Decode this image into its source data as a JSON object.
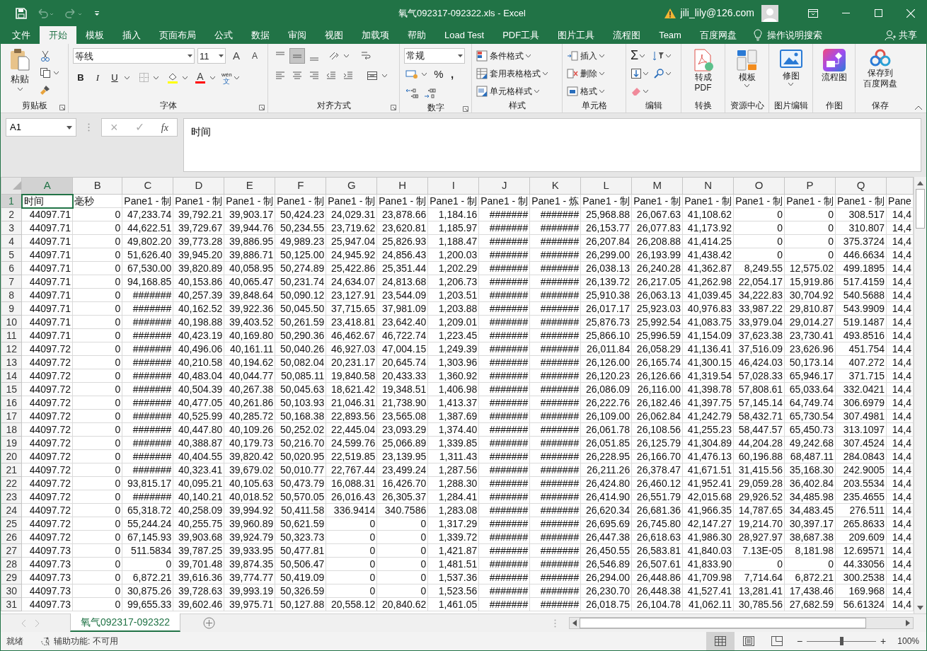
{
  "window": {
    "title": "氧气092317-092322.xls  -  Excel",
    "user": "jili_lily@126.com"
  },
  "ribbon_tabs": [
    {
      "label": "文件",
      "selected": false
    },
    {
      "label": "开始",
      "selected": true
    },
    {
      "label": "模板",
      "selected": false
    },
    {
      "label": "插入",
      "selected": false
    },
    {
      "label": "页面布局",
      "selected": false
    },
    {
      "label": "公式",
      "selected": false
    },
    {
      "label": "数据",
      "selected": false
    },
    {
      "label": "审阅",
      "selected": false
    },
    {
      "label": "视图",
      "selected": false
    },
    {
      "label": "加载项",
      "selected": false
    },
    {
      "label": "帮助",
      "selected": false
    },
    {
      "label": "Load Test",
      "selected": false
    },
    {
      "label": "PDF工具",
      "selected": false
    },
    {
      "label": "图片工具",
      "selected": false
    },
    {
      "label": "流程图",
      "selected": false
    },
    {
      "label": "Team",
      "selected": false
    },
    {
      "label": "百度网盘",
      "selected": false
    }
  ],
  "tell_me": "操作说明搜索",
  "share": "共享",
  "ribbon": {
    "clipboard": {
      "paste": "粘贴",
      "label": "剪贴板"
    },
    "font": {
      "name": "等线",
      "size": "11",
      "grow": "A",
      "shrink": "A",
      "bold": "B",
      "italic": "I",
      "underline": "U",
      "font_color": "A",
      "phonetic": "wén",
      "phonetic_char": "文",
      "label": "字体"
    },
    "alignment": {
      "buttons": [
        {
          "kind": "top",
          "selected": false
        },
        {
          "kind": "middle",
          "selected": true
        },
        {
          "kind": "bottom",
          "selected": false
        }
      ],
      "label": "对齐方式"
    },
    "number": {
      "format": "常规",
      "percent": "%",
      "comma": ",",
      "label": "数字"
    },
    "styles": {
      "items": [
        "条件格式",
        "套用表格格式",
        "单元格样式"
      ],
      "label": "样式"
    },
    "cells": {
      "items": [
        "插入",
        "删除",
        "格式"
      ],
      "label": "单元格"
    },
    "editing": {
      "autosum": "Σ",
      "label": "编辑"
    },
    "big_groups": [
      {
        "kind": "pdf",
        "lines": [
          "转成",
          "PDF"
        ],
        "caret": false,
        "label": "转换"
      },
      {
        "kind": "template",
        "lines": [
          "模板"
        ],
        "caret": true,
        "label": "资源中心"
      },
      {
        "kind": "image",
        "lines": [
          "修图"
        ],
        "caret": true,
        "label": "图片编辑"
      },
      {
        "kind": "flow",
        "lines": [
          "流程图"
        ],
        "caret": false,
        "label": "作图"
      },
      {
        "kind": "cloud",
        "lines": [
          "保存到",
          "百度网盘"
        ],
        "caret": false,
        "label": "保存"
      }
    ]
  },
  "formula_bar": {
    "name_box": "A1",
    "cancel": "×",
    "enter": "✓",
    "fx": "fx",
    "formula": "时间"
  },
  "columns": [
    {
      "letter": "A",
      "selected": true
    },
    {
      "letter": "B",
      "selected": false
    },
    {
      "letter": "C",
      "selected": false
    },
    {
      "letter": "D",
      "selected": false
    },
    {
      "letter": "E",
      "selected": false
    },
    {
      "letter": "F",
      "selected": false
    },
    {
      "letter": "G",
      "selected": false
    },
    {
      "letter": "H",
      "selected": false
    },
    {
      "letter": "I",
      "selected": false
    },
    {
      "letter": "J",
      "selected": false
    },
    {
      "letter": "K",
      "selected": false
    },
    {
      "letter": "L",
      "selected": false
    },
    {
      "letter": "M",
      "selected": false
    },
    {
      "letter": "N",
      "selected": false
    },
    {
      "letter": "O",
      "selected": false
    },
    {
      "letter": "P",
      "selected": false
    },
    {
      "letter": "Q",
      "selected": false
    }
  ],
  "rows": [
    {
      "number": "1",
      "selected": true,
      "kind": "header",
      "cells": [
        "时间",
        "毫秒",
        "Pane1 - 制",
        "Pane1 - 制",
        "Pane1 - 制",
        "Pane1 - 制",
        "Pane1 - 制",
        "Pane1 - 制",
        "Pane1 - 制",
        "Pane1 - 制",
        "Pane1 - 炼",
        "Pane1 - 制",
        "Pane1 - 制",
        "Pane1 - 制",
        "Pane1 - 制",
        "Pane1 - 制",
        "Pane1 - 制",
        "Pane"
      ]
    },
    {
      "number": "2",
      "selected": false,
      "kind": "data",
      "cells": [
        "44097.71",
        "0",
        "47,233.74",
        "39,792.21",
        "39,903.17",
        "50,424.23",
        "24,029.31",
        "23,878.66",
        "1,184.16",
        "#######",
        "#######",
        "25,968.88",
        "26,067.63",
        "41,108.62",
        "0",
        "0",
        "308.517",
        "14,4"
      ]
    },
    {
      "number": "3",
      "selected": false,
      "kind": "data",
      "cells": [
        "44097.71",
        "0",
        "44,622.51",
        "39,729.67",
        "39,944.76",
        "50,234.55",
        "23,719.62",
        "23,620.81",
        "1,185.97",
        "#######",
        "#######",
        "26,153.77",
        "26,077.83",
        "41,173.92",
        "0",
        "0",
        "310.807",
        "14,4"
      ]
    },
    {
      "number": "4",
      "selected": false,
      "kind": "data",
      "cells": [
        "44097.71",
        "0",
        "49,802.20",
        "39,773.28",
        "39,886.95",
        "49,989.23",
        "25,947.04",
        "25,826.93",
        "1,188.47",
        "#######",
        "#######",
        "26,207.84",
        "26,208.88",
        "41,414.25",
        "0",
        "0",
        "375.3724",
        "14,4"
      ]
    },
    {
      "number": "5",
      "selected": false,
      "kind": "data",
      "cells": [
        "44097.71",
        "0",
        "51,626.40",
        "39,945.20",
        "39,886.71",
        "50,125.00",
        "24,945.92",
        "24,856.43",
        "1,200.03",
        "#######",
        "#######",
        "26,299.00",
        "26,193.99",
        "41,438.42",
        "0",
        "0",
        "446.6634",
        "14,4"
      ]
    },
    {
      "number": "6",
      "selected": false,
      "kind": "data",
      "cells": [
        "44097.71",
        "0",
        "67,530.00",
        "39,820.89",
        "40,058.95",
        "50,274.89",
        "25,422.86",
        "25,351.44",
        "1,202.29",
        "#######",
        "#######",
        "26,038.13",
        "26,240.28",
        "41,362.87",
        "8,249.55",
        "12,575.02",
        "499.1895",
        "14,4"
      ]
    },
    {
      "number": "7",
      "selected": false,
      "kind": "data",
      "cells": [
        "44097.71",
        "0",
        "94,168.85",
        "40,153.86",
        "40,065.47",
        "50,231.74",
        "24,634.07",
        "24,813.68",
        "1,206.73",
        "#######",
        "#######",
        "26,139.72",
        "26,217.05",
        "41,262.98",
        "22,054.17",
        "15,919.86",
        "517.4159",
        "14,4"
      ]
    },
    {
      "number": "8",
      "selected": false,
      "kind": "data",
      "cells": [
        "44097.71",
        "0",
        "#######",
        "40,257.39",
        "39,848.64",
        "50,090.12",
        "23,127.91",
        "23,544.09",
        "1,203.51",
        "#######",
        "#######",
        "25,910.38",
        "26,063.13",
        "41,039.45",
        "34,222.83",
        "30,704.92",
        "540.5688",
        "14,4"
      ]
    },
    {
      "number": "9",
      "selected": false,
      "kind": "data",
      "cells": [
        "44097.71",
        "0",
        "#######",
        "40,162.52",
        "39,922.36",
        "50,045.50",
        "37,715.65",
        "37,981.09",
        "1,203.88",
        "#######",
        "#######",
        "26,017.17",
        "25,923.03",
        "40,976.83",
        "33,987.22",
        "29,810.87",
        "543.9909",
        "14,4"
      ]
    },
    {
      "number": "10",
      "selected": false,
      "kind": "data",
      "cells": [
        "44097.71",
        "0",
        "#######",
        "40,198.88",
        "39,403.52",
        "50,261.59",
        "23,418.81",
        "23,642.40",
        "1,209.01",
        "#######",
        "#######",
        "25,876.73",
        "25,992.54",
        "41,083.75",
        "33,979.04",
        "29,014.27",
        "519.1487",
        "14,4"
      ]
    },
    {
      "number": "11",
      "selected": false,
      "kind": "data",
      "cells": [
        "44097.71",
        "0",
        "#######",
        "40,423.19",
        "40,169.80",
        "50,290.36",
        "46,462.67",
        "46,722.74",
        "1,223.45",
        "#######",
        "#######",
        "25,866.10",
        "25,996.59",
        "41,154.09",
        "37,623.38",
        "23,730.41",
        "493.8516",
        "14,4"
      ]
    },
    {
      "number": "12",
      "selected": false,
      "kind": "data",
      "cells": [
        "44097.72",
        "0",
        "#######",
        "40,496.06",
        "40,161.11",
        "50,040.26",
        "46,927.03",
        "47,004.15",
        "1,249.39",
        "#######",
        "#######",
        "26,011.84",
        "26,058.29",
        "41,136.41",
        "37,516.09",
        "23,626.96",
        "451.754",
        "14,4"
      ]
    },
    {
      "number": "13",
      "selected": false,
      "kind": "data",
      "cells": [
        "44097.72",
        "0",
        "#######",
        "40,210.58",
        "40,194.62",
        "50,082.04",
        "20,231.17",
        "20,645.74",
        "1,303.96",
        "#######",
        "#######",
        "26,126.00",
        "26,165.74",
        "41,300.15",
        "46,424.03",
        "50,173.14",
        "407.272",
        "14,4"
      ]
    },
    {
      "number": "14",
      "selected": false,
      "kind": "data",
      "cells": [
        "44097.72",
        "0",
        "#######",
        "40,483.04",
        "40,044.77",
        "50,085.11",
        "19,840.58",
        "20,433.33",
        "1,360.92",
        "#######",
        "#######",
        "26,120.23",
        "26,126.66",
        "41,319.54",
        "57,028.33",
        "65,946.17",
        "371.715",
        "14,4"
      ]
    },
    {
      "number": "15",
      "selected": false,
      "kind": "data",
      "cells": [
        "44097.72",
        "0",
        "#######",
        "40,504.39",
        "40,267.38",
        "50,045.63",
        "18,621.42",
        "19,348.51",
        "1,406.98",
        "#######",
        "#######",
        "26,086.09",
        "26,116.00",
        "41,398.78",
        "57,808.61",
        "65,033.64",
        "332.0421",
        "14,4"
      ]
    },
    {
      "number": "16",
      "selected": false,
      "kind": "data",
      "cells": [
        "44097.72",
        "0",
        "#######",
        "40,477.05",
        "40,261.86",
        "50,103.93",
        "21,046.31",
        "21,738.90",
        "1,413.37",
        "#######",
        "#######",
        "26,222.76",
        "26,182.46",
        "41,397.75",
        "57,145.14",
        "64,749.74",
        "306.6979",
        "14,4"
      ]
    },
    {
      "number": "17",
      "selected": false,
      "kind": "data",
      "cells": [
        "44097.72",
        "0",
        "#######",
        "40,525.99",
        "40,285.72",
        "50,168.38",
        "22,893.56",
        "23,565.08",
        "1,387.69",
        "#######",
        "#######",
        "26,109.00",
        "26,062.84",
        "41,242.79",
        "58,432.71",
        "65,730.54",
        "307.4981",
        "14,4"
      ]
    },
    {
      "number": "18",
      "selected": false,
      "kind": "data",
      "cells": [
        "44097.72",
        "0",
        "#######",
        "40,447.80",
        "40,109.26",
        "50,252.02",
        "22,445.04",
        "23,093.29",
        "1,374.40",
        "#######",
        "#######",
        "26,061.78",
        "26,108.56",
        "41,255.23",
        "58,447.57",
        "65,450.73",
        "313.1097",
        "14,4"
      ]
    },
    {
      "number": "19",
      "selected": false,
      "kind": "data",
      "cells": [
        "44097.72",
        "0",
        "#######",
        "40,388.87",
        "40,179.73",
        "50,216.70",
        "24,599.76",
        "25,066.89",
        "1,339.85",
        "#######",
        "#######",
        "26,051.85",
        "26,125.79",
        "41,304.89",
        "44,204.28",
        "49,242.68",
        "307.4524",
        "14,4"
      ]
    },
    {
      "number": "20",
      "selected": false,
      "kind": "data",
      "cells": [
        "44097.72",
        "0",
        "#######",
        "40,404.55",
        "39,820.42",
        "50,020.95",
        "22,519.85",
        "23,139.95",
        "1,311.43",
        "#######",
        "#######",
        "26,228.95",
        "26,166.70",
        "41,476.13",
        "60,196.88",
        "68,487.11",
        "284.0843",
        "14,4"
      ]
    },
    {
      "number": "21",
      "selected": false,
      "kind": "data",
      "cells": [
        "44097.72",
        "0",
        "#######",
        "40,323.41",
        "39,679.02",
        "50,010.77",
        "22,767.44",
        "23,499.24",
        "1,287.56",
        "#######",
        "#######",
        "26,211.26",
        "26,378.47",
        "41,671.51",
        "31,415.56",
        "35,168.30",
        "242.9005",
        "14,4"
      ]
    },
    {
      "number": "22",
      "selected": false,
      "kind": "data",
      "cells": [
        "44097.72",
        "0",
        "93,815.17",
        "40,095.21",
        "40,105.63",
        "50,473.79",
        "16,088.31",
        "16,426.70",
        "1,288.30",
        "#######",
        "#######",
        "26,424.80",
        "26,460.12",
        "41,952.41",
        "29,059.28",
        "36,402.84",
        "203.5534",
        "14,4"
      ]
    },
    {
      "number": "23",
      "selected": false,
      "kind": "data",
      "cells": [
        "44097.72",
        "0",
        "#######",
        "40,140.21",
        "40,018.52",
        "50,570.05",
        "26,016.43",
        "26,305.37",
        "1,284.41",
        "#######",
        "#######",
        "26,414.90",
        "26,551.79",
        "42,015.68",
        "29,926.52",
        "34,485.98",
        "235.4655",
        "14,4"
      ]
    },
    {
      "number": "24",
      "selected": false,
      "kind": "data",
      "cells": [
        "44097.72",
        "0",
        "65,318.72",
        "40,258.09",
        "39,994.92",
        "50,411.58",
        "336.9414",
        "340.7586",
        "1,283.08",
        "#######",
        "#######",
        "26,620.34",
        "26,681.36",
        "41,966.35",
        "14,787.65",
        "34,483.45",
        "276.511",
        "14,4"
      ]
    },
    {
      "number": "25",
      "selected": false,
      "kind": "data",
      "cells": [
        "44097.72",
        "0",
        "55,244.24",
        "40,255.75",
        "39,960.89",
        "50,621.59",
        "0",
        "0",
        "1,317.29",
        "#######",
        "#######",
        "26,695.69",
        "26,745.80",
        "42,147.27",
        "19,214.70",
        "30,397.17",
        "265.8633",
        "14,4"
      ]
    },
    {
      "number": "26",
      "selected": false,
      "kind": "data",
      "cells": [
        "44097.72",
        "0",
        "67,145.93",
        "39,903.68",
        "39,924.79",
        "50,323.73",
        "0",
        "0",
        "1,339.72",
        "#######",
        "#######",
        "26,447.38",
        "26,618.63",
        "41,986.30",
        "28,927.97",
        "38,687.38",
        "209.609",
        "14,4"
      ]
    },
    {
      "number": "27",
      "selected": false,
      "kind": "data",
      "cells": [
        "44097.73",
        "0",
        "511.5834",
        "39,787.25",
        "39,933.95",
        "50,477.81",
        "0",
        "0",
        "1,421.87",
        "#######",
        "#######",
        "26,450.55",
        "26,583.81",
        "41,840.03",
        "7.13E-05",
        "8,181.98",
        "12.69571",
        "14,4"
      ]
    },
    {
      "number": "28",
      "selected": false,
      "kind": "data",
      "cells": [
        "44097.73",
        "0",
        "0",
        "39,701.48",
        "39,874.35",
        "50,506.47",
        "0",
        "0",
        "1,481.51",
        "#######",
        "#######",
        "26,546.89",
        "26,507.61",
        "41,833.90",
        "0",
        "0",
        "44.33056",
        "14,4"
      ]
    },
    {
      "number": "29",
      "selected": false,
      "kind": "data",
      "cells": [
        "44097.73",
        "0",
        "6,872.21",
        "39,616.36",
        "39,774.77",
        "50,419.09",
        "0",
        "0",
        "1,537.36",
        "#######",
        "#######",
        "26,294.00",
        "26,448.86",
        "41,709.98",
        "7,714.64",
        "6,872.21",
        "300.2538",
        "14,4"
      ]
    },
    {
      "number": "30",
      "selected": false,
      "kind": "data",
      "cells": [
        "44097.73",
        "0",
        "30,875.26",
        "39,728.63",
        "39,993.19",
        "50,326.59",
        "0",
        "0",
        "1,523.56",
        "#######",
        "#######",
        "26,230.70",
        "26,448.38",
        "41,527.41",
        "13,281.41",
        "17,438.46",
        "169.968",
        "14,4"
      ]
    },
    {
      "number": "31",
      "selected": false,
      "kind": "data",
      "cells": [
        "44097.73",
        "0",
        "99,655.33",
        "39,602.46",
        "39,975.71",
        "50,127.88",
        "20,558.12",
        "20,840.62",
        "1,461.05",
        "#######",
        "#######",
        "26,018.75",
        "26,104.78",
        "41,062.11",
        "30,785.56",
        "27,682.59",
        "56.61324",
        "14,4"
      ]
    }
  ],
  "sheet_tabs": [
    {
      "label": "氧气092317-092322",
      "selected": true
    }
  ],
  "status_bar": {
    "state": "就绪",
    "accessibility": "辅助功能: 不可用",
    "views": [
      {
        "kind": "normal",
        "selected": true
      },
      {
        "kind": "page_layout",
        "selected": false
      },
      {
        "kind": "page_break",
        "selected": false
      }
    ],
    "zoom_out": "−",
    "zoom_in": "+",
    "zoom_slider": {
      "level": 0.5
    },
    "zoom": "100%"
  }
}
